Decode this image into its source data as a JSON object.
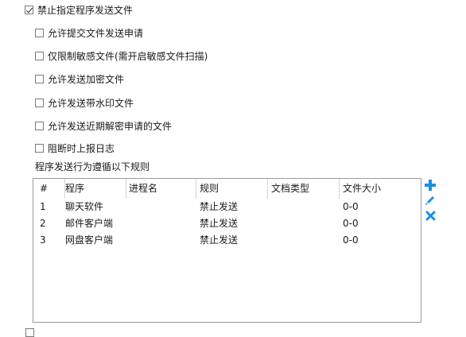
{
  "options": {
    "main": "禁止指定程序发送文件",
    "items": [
      "允许提交文件发送申请",
      "仅限制敏感文件(需开启敏感文件扫描)",
      "允许发送加密文件",
      "允许发送带水印文件",
      "允许发送近期解密申请的文件",
      "阻断时上报日志"
    ]
  },
  "rules_label": "程序发送行为遵循以下规则",
  "table": {
    "headers": [
      "#",
      "程序",
      "进程名",
      "规则",
      "文档类型",
      "文件大小"
    ],
    "rows": [
      [
        "1",
        "聊天软件",
        "",
        "禁止发送",
        "",
        "0-0"
      ],
      [
        "2",
        "邮件客户端",
        "",
        "禁止发送",
        "",
        "0-0"
      ],
      [
        "3",
        "网盘客户端",
        "",
        "禁止发送",
        "",
        "0-0"
      ]
    ]
  },
  "colors": {
    "icon_blue": "#1a8fe0"
  },
  "tools": [
    "add-icon",
    "edit-icon",
    "delete-icon"
  ]
}
